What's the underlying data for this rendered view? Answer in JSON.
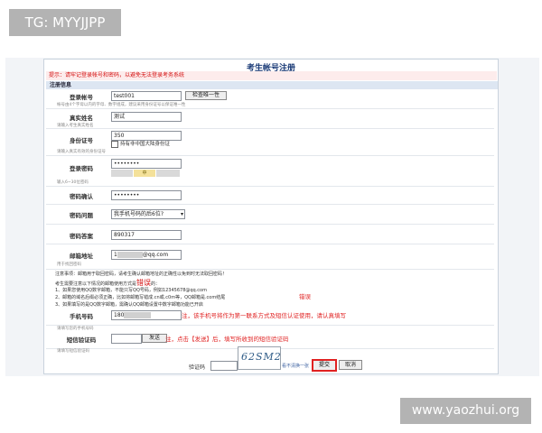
{
  "watermarks": {
    "top_left": "TG: MYYJJPP",
    "bottom_right": "www.yaozhui.org"
  },
  "page": {
    "title": "考生帐号注册",
    "warning": "提示：请牢记登录帐号和密码，以避免无法登录考务系统",
    "section": "注册信息"
  },
  "fields": {
    "account": {
      "label": "登录帐号",
      "value": "test001",
      "check_button": "检查唯一性",
      "hint": "帐号由4个字母以内的字母、数字组成，建议采用身份证号以保证唯一性"
    },
    "name": {
      "label": "真实姓名",
      "value": "测试",
      "hint": "请输入考生真实姓名"
    },
    "id_card": {
      "label": "身份证号",
      "value": "350",
      "checkbox_label": "持有非中国大陆身份证",
      "hint": "请输入真实有效的身份证号"
    },
    "password": {
      "label": "登录密码",
      "value": "••••••••",
      "strength": "中",
      "hint": "输入6~30位密码"
    },
    "confirm": {
      "label": "密码确认",
      "value": "••••••••"
    },
    "question": {
      "label": "密码问题",
      "value": "我手机号码的后6位?"
    },
    "answer": {
      "label": "密码答案",
      "value": "890317"
    },
    "email": {
      "label": "邮箱地址",
      "value": "1",
      "value_suffix": "@qq.com",
      "hint": "用于找回密码"
    },
    "phone": {
      "label": "手机号码",
      "value": "180",
      "hint": "请填写您的手机号码"
    },
    "sms": {
      "label": "短信验证码",
      "send_button": "发送",
      "hint": "请填写短信验证码"
    }
  },
  "notes": {
    "l1": "注意事项：邮箱用于取回密码，请考生确认邮箱地址的正确性以免到时无法取回密码！",
    "l2a": "考生需要注意以下情况的邮箱使用方式是",
    "l2b": "错误",
    "l2c": "的：",
    "l3": "1、如果您使用QQ数字邮箱，不能只写QQ号码，例如12345678@qq.com",
    "l4": "2、邮箱的域名后缀必须正确，比如将邮箱写错成.cn或.c0m等，QQ邮箱是.com结尾",
    "l5": "3、如果填写的是QQ数字邮箱，需确认QQ邮箱设置中数字邮箱功能已开启"
  },
  "annotations": {
    "cuowu": "错误",
    "phone": "注，该手机号将作为第一联系方式及短信认证使用，请认真填写",
    "sms": "注，点击【发送】后，填写所收到的短信验证码"
  },
  "captcha": {
    "label": "验证码",
    "image_text": "62SM2",
    "refresh": "看不清换一张"
  },
  "actions": {
    "submit": "提交",
    "cancel": "取消"
  },
  "colors": {
    "warning": "#d41212",
    "annotation": "#e02121",
    "section": "#dde6f2",
    "strength": "#f4e19a"
  }
}
